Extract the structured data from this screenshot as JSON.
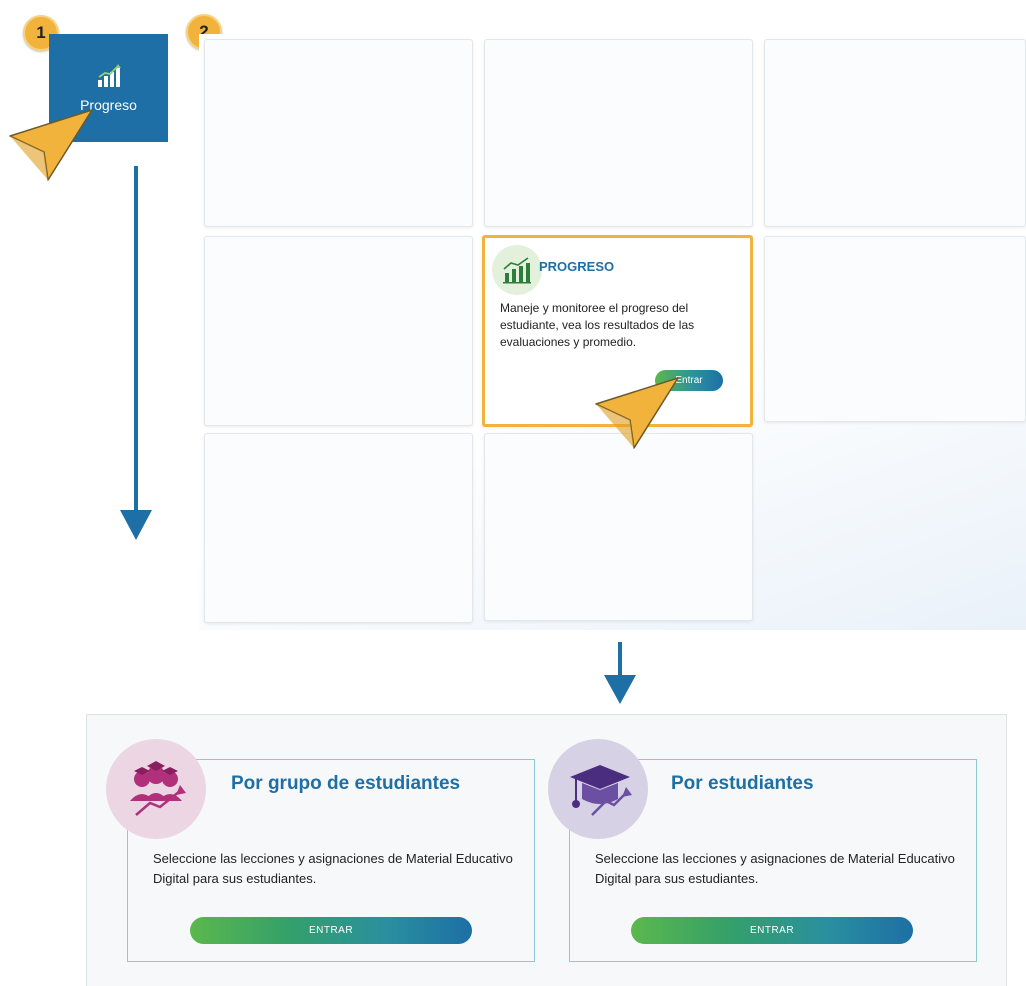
{
  "steps": {
    "step1": "1",
    "step2": "2"
  },
  "sidebar_tile": {
    "label": "Progreso",
    "icon": "bar-chart-growth-icon",
    "color": "#1d6fa5"
  },
  "progress_card": {
    "title": "PROGRESO",
    "description": "Maneje y monitoree el progreso del estudiante, vea los resultados de las evaluaciones y promedio.",
    "button_label": "Entrar",
    "icon": "bar-chart-growth-icon"
  },
  "options": [
    {
      "title": "Por grupo de estudiantes",
      "description": "Seleccione las lecciones y asignaciones de Material Educativo Digital para sus estudiantes.",
      "button_label": "ENTRAR",
      "icon": "student-group-growth-icon"
    },
    {
      "title": "Por estudiantes",
      "description": "Seleccione las lecciones y asignaciones de Material Educativo Digital para sus estudiantes.",
      "button_label": "ENTRAR",
      "icon": "graduation-cap-growth-icon"
    }
  ],
  "colors": {
    "accent_blue": "#1d6fa5",
    "highlight_yellow": "#f2b33d",
    "gradient_green": "#5bb84c"
  }
}
